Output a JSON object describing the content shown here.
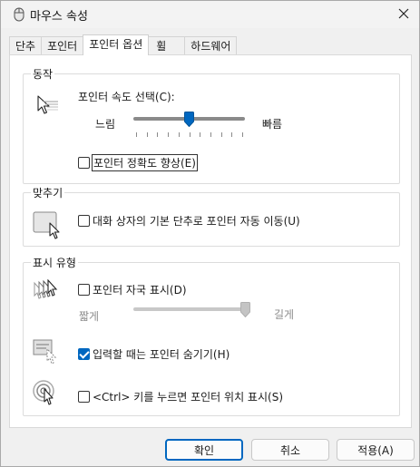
{
  "window": {
    "title": "마우스 속성"
  },
  "tabs": [
    {
      "label": "단추",
      "active": false
    },
    {
      "label": "포인터",
      "active": false
    },
    {
      "label": "포인터 옵션",
      "active": true
    },
    {
      "label": "휠",
      "active": false
    },
    {
      "label": "하드웨어",
      "active": false
    }
  ],
  "motion": {
    "group_label": "동작",
    "speed_label": "포인터 속도 선택(C):",
    "slow_label": "느림",
    "fast_label": "빠름",
    "speed_level": 0.5,
    "precision_label": "포인터 정확도 향상(E)",
    "precision_checked": false
  },
  "snap": {
    "group_label": "맞추기",
    "snap_label": "대화 상자의 기본 단추로 포인터 자동 이동(U)",
    "snap_checked": false
  },
  "visibility": {
    "group_label": "표시 유형",
    "trails_label": "포인터 자국 표시(D)",
    "trails_checked": false,
    "short_label": "짧게",
    "long_label": "길게",
    "trails_level": 1.0,
    "hide_label": "입력할 때는 포인터 숨기기(H)",
    "hide_checked": true,
    "ctrl_label": "<Ctrl> 키를 누르면 포인터 위치 표시(S)",
    "ctrl_checked": false
  },
  "buttons": {
    "ok": "확인",
    "cancel": "취소",
    "apply": "적용(A)"
  },
  "colors": {
    "accent": "#0067c0"
  }
}
